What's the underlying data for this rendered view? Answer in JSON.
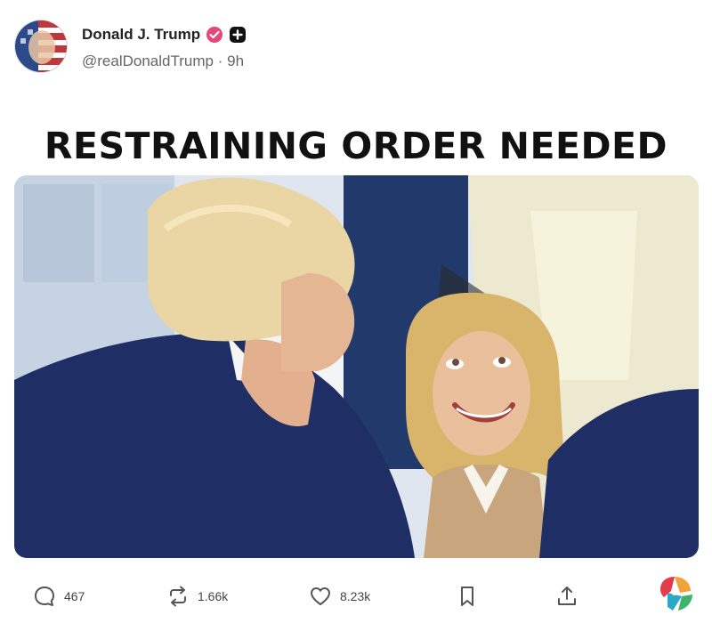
{
  "post": {
    "author_name": "Donald J. Trump",
    "handle": "@realDonaldTrump",
    "separator": "·",
    "time_ago": "9h",
    "headline": "RESTRAINING ORDER NEEDED"
  },
  "actions": {
    "comments": "467",
    "reposts": "1.66k",
    "likes": "8.23k"
  },
  "icons": {
    "comment": "comment-icon",
    "repost": "repost-icon",
    "like": "heart-icon",
    "bookmark": "bookmark-icon",
    "share": "share-icon",
    "verified": "verified-badge-icon",
    "plus": "plus-badge-icon",
    "app_logo": "app-logo-icon"
  },
  "colors": {
    "verified": "#e5477a",
    "text_muted": "#666666",
    "suit_navy": "#1f2f66",
    "hair_blonde": "#e9d6a4"
  }
}
